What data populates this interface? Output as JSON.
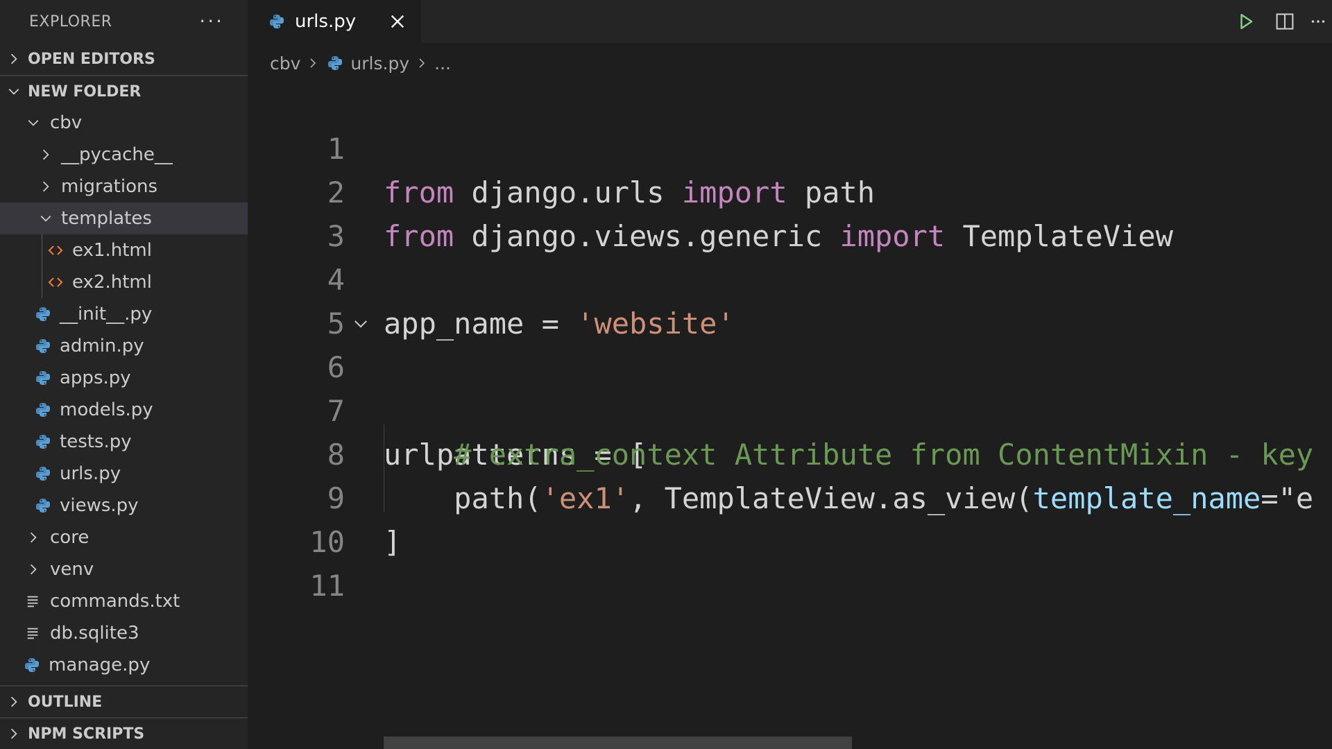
{
  "explorer": {
    "title": "EXPLORER",
    "more": "···"
  },
  "sections": {
    "open_editors": "OPEN EDITORS",
    "folder": "NEW FOLDER",
    "outline": "OUTLINE",
    "npm_scripts": "NPM SCRIPTS"
  },
  "tree": [
    {
      "label": "cbv",
      "type": "folder-open",
      "icon": "chevron-down-icon"
    },
    {
      "label": "__pycache__",
      "type": "folder-closed",
      "icon": "chevron-right-icon"
    },
    {
      "label": "migrations",
      "type": "folder-closed",
      "icon": "chevron-right-icon"
    },
    {
      "label": "templates",
      "type": "folder-open",
      "icon": "chevron-down-icon"
    },
    {
      "label": "ex1.html",
      "type": "html",
      "icon": "html-file-icon"
    },
    {
      "label": "ex2.html",
      "type": "html",
      "icon": "html-file-icon"
    },
    {
      "label": "__init__.py",
      "type": "python",
      "icon": "python-file-icon"
    },
    {
      "label": "admin.py",
      "type": "python",
      "icon": "python-file-icon"
    },
    {
      "label": "apps.py",
      "type": "python",
      "icon": "python-file-icon"
    },
    {
      "label": "models.py",
      "type": "python",
      "icon": "python-file-icon"
    },
    {
      "label": "tests.py",
      "type": "python",
      "icon": "python-file-icon"
    },
    {
      "label": "urls.py",
      "type": "python",
      "icon": "python-file-icon"
    },
    {
      "label": "views.py",
      "type": "python",
      "icon": "python-file-icon"
    },
    {
      "label": "core",
      "type": "folder-closed",
      "icon": "chevron-right-icon"
    },
    {
      "label": "venv",
      "type": "folder-closed",
      "icon": "chevron-right-icon"
    },
    {
      "label": "commands.txt",
      "type": "text",
      "icon": "text-file-icon"
    },
    {
      "label": "db.sqlite3",
      "type": "text",
      "icon": "text-file-icon"
    },
    {
      "label": "manage.py",
      "type": "python",
      "icon": "python-file-icon"
    }
  ],
  "tab": {
    "label": "urls.py"
  },
  "breadcrumb": {
    "folder": "cbv",
    "file": "urls.py",
    "more": "..."
  },
  "code": {
    "line_numbers": [
      "1",
      "2",
      "3",
      "4",
      "5",
      "6",
      "7",
      "8",
      "9",
      "10",
      "11"
    ],
    "l1": {
      "from": "from",
      "mod": " django.urls ",
      "imp": "import",
      "name": " path"
    },
    "l2": {
      "from": "from",
      "mod": " django.views.generic ",
      "imp": "import",
      "name": " TemplateView"
    },
    "l4": {
      "var": "app_name = ",
      "str": "'website'"
    },
    "l6": {
      "text": "urlpatterns = ["
    },
    "l7": {
      "indent": "    ",
      "comment": "# extra_context Attribute from ContentMixin - key"
    },
    "l8": {
      "indent": "    ",
      "a": "path(",
      "s": "'ex1'",
      "b": ", TemplateView.as_view(",
      "param": "template_name",
      "c": "=\"e"
    },
    "l9": {
      "text": "]"
    }
  },
  "colors": {
    "keyword": "#c586c0",
    "string": "#ce9178",
    "comment": "#6a9955",
    "parameter": "#9cdcfe",
    "python_icon": "#4b8bbe",
    "html_icon": "#e37933",
    "run_icon": "#89d185"
  }
}
